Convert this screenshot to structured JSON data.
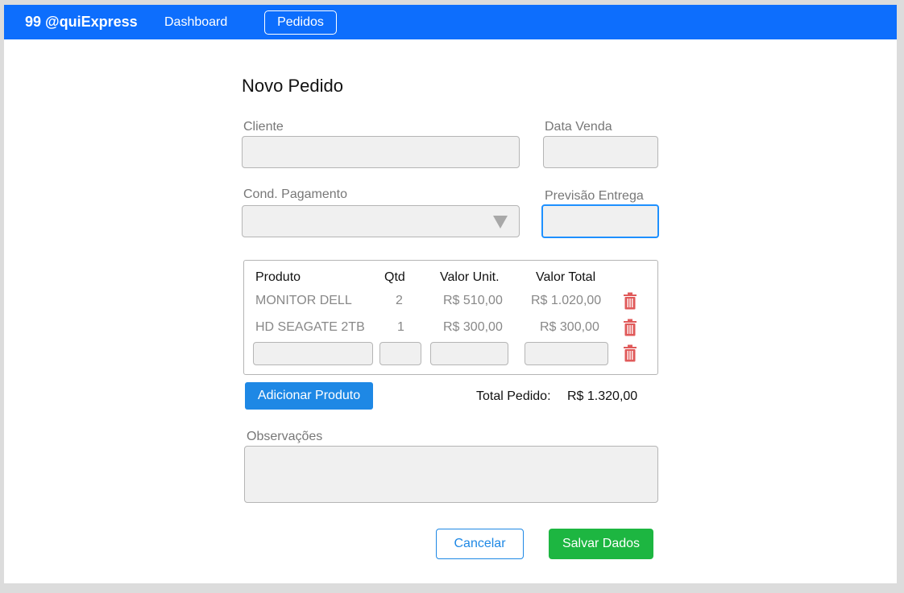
{
  "navbar": {
    "brand": "99 @quiExpress",
    "links": [
      {
        "label": "Dashboard"
      },
      {
        "label": "Pedidos"
      }
    ]
  },
  "form": {
    "title": "Novo Pedido",
    "cliente_label": "Cliente",
    "cliente_value": "",
    "data_venda_label": "Data Venda",
    "data_venda_value": "",
    "cond_pagamento_label": "Cond. Pagamento",
    "cond_pagamento_value": "",
    "previsao_entrega_label": "Previsão Entrega",
    "previsao_entrega_value": "",
    "observacoes_label": "Observações",
    "observacoes_value": ""
  },
  "items_table": {
    "headers": [
      "Produto",
      "Qtd",
      "Valor Unit.",
      "Valor Total"
    ],
    "rows": [
      {
        "produto": "MONITOR DELL",
        "qtd": "2",
        "valor_unit": "R$ 510,00",
        "valor_total": "R$ 1.020,00"
      },
      {
        "produto": "HD SEAGATE 2TB",
        "qtd": "1",
        "valor_unit": "R$ 300,00",
        "valor_total": "R$ 300,00"
      }
    ]
  },
  "actions": {
    "add_product_label": "Adicionar Produto",
    "total_label": "Total Pedido:",
    "total_value": "R$ 1.320,00",
    "cancel_label": "Cancelar",
    "save_label": "Salvar Dados"
  },
  "colors": {
    "navbar": "#0d6efd",
    "primary_button": "#1e88e5",
    "save_button": "#1db641",
    "trash_icon": "#e05a5a",
    "focus_border": "#1e90ff"
  }
}
